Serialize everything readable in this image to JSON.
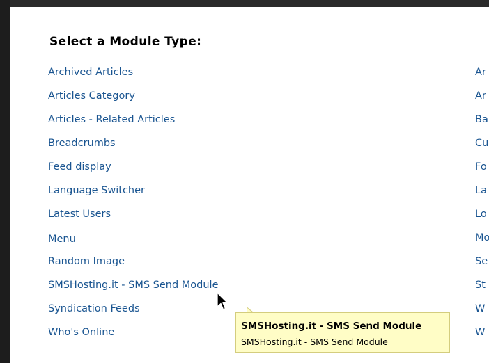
{
  "modal": {
    "title": "Select a Module Type:"
  },
  "modules_left": [
    "Archived Articles",
    "Articles Category",
    "Articles - Related Articles",
    "Breadcrumbs",
    "Feed display",
    "Language Switcher",
    "Latest Users",
    "Menu",
    "Random Image",
    "SMSHosting.it - SMS Send Module",
    "Syndication Feeds",
    "Who's Online"
  ],
  "modules_right_visible": [
    "Ar",
    "Ar",
    "Ba",
    "Cu",
    "Fo",
    "La",
    "Lo",
    "Mo",
    "Se",
    "St",
    "W",
    "W"
  ],
  "tooltip": {
    "title": "SMSHosting.it - SMS Send Module",
    "description": "SMSHosting.it - SMS Send Module"
  },
  "colors": {
    "link": "#1a5591",
    "tooltip_bg": "#fffdc6",
    "overlay": "#555555"
  }
}
